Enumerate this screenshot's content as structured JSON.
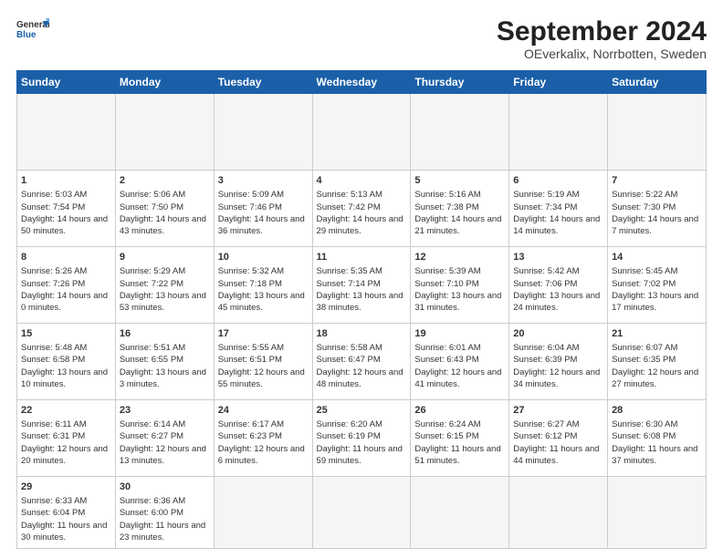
{
  "header": {
    "logo_line1": "General",
    "logo_line2": "Blue",
    "title": "September 2024",
    "subtitle": "OEverkalix, Norrbotten, Sweden"
  },
  "calendar": {
    "days_of_week": [
      "Sunday",
      "Monday",
      "Tuesday",
      "Wednesday",
      "Thursday",
      "Friday",
      "Saturday"
    ],
    "weeks": [
      [
        {
          "day": "",
          "empty": true
        },
        {
          "day": "",
          "empty": true
        },
        {
          "day": "",
          "empty": true
        },
        {
          "day": "",
          "empty": true
        },
        {
          "day": "",
          "empty": true
        },
        {
          "day": "",
          "empty": true
        },
        {
          "day": "",
          "empty": true
        }
      ],
      [
        {
          "num": "1",
          "rise": "Sunrise: 5:03 AM",
          "set": "Sunset: 7:54 PM",
          "daylight": "Daylight: 14 hours and 50 minutes."
        },
        {
          "num": "2",
          "rise": "Sunrise: 5:06 AM",
          "set": "Sunset: 7:50 PM",
          "daylight": "Daylight: 14 hours and 43 minutes."
        },
        {
          "num": "3",
          "rise": "Sunrise: 5:09 AM",
          "set": "Sunset: 7:46 PM",
          "daylight": "Daylight: 14 hours and 36 minutes."
        },
        {
          "num": "4",
          "rise": "Sunrise: 5:13 AM",
          "set": "Sunset: 7:42 PM",
          "daylight": "Daylight: 14 hours and 29 minutes."
        },
        {
          "num": "5",
          "rise": "Sunrise: 5:16 AM",
          "set": "Sunset: 7:38 PM",
          "daylight": "Daylight: 14 hours and 21 minutes."
        },
        {
          "num": "6",
          "rise": "Sunrise: 5:19 AM",
          "set": "Sunset: 7:34 PM",
          "daylight": "Daylight: 14 hours and 14 minutes."
        },
        {
          "num": "7",
          "rise": "Sunrise: 5:22 AM",
          "set": "Sunset: 7:30 PM",
          "daylight": "Daylight: 14 hours and 7 minutes."
        }
      ],
      [
        {
          "num": "8",
          "rise": "Sunrise: 5:26 AM",
          "set": "Sunset: 7:26 PM",
          "daylight": "Daylight: 14 hours and 0 minutes."
        },
        {
          "num": "9",
          "rise": "Sunrise: 5:29 AM",
          "set": "Sunset: 7:22 PM",
          "daylight": "Daylight: 13 hours and 53 minutes."
        },
        {
          "num": "10",
          "rise": "Sunrise: 5:32 AM",
          "set": "Sunset: 7:18 PM",
          "daylight": "Daylight: 13 hours and 45 minutes."
        },
        {
          "num": "11",
          "rise": "Sunrise: 5:35 AM",
          "set": "Sunset: 7:14 PM",
          "daylight": "Daylight: 13 hours and 38 minutes."
        },
        {
          "num": "12",
          "rise": "Sunrise: 5:39 AM",
          "set": "Sunset: 7:10 PM",
          "daylight": "Daylight: 13 hours and 31 minutes."
        },
        {
          "num": "13",
          "rise": "Sunrise: 5:42 AM",
          "set": "Sunset: 7:06 PM",
          "daylight": "Daylight: 13 hours and 24 minutes."
        },
        {
          "num": "14",
          "rise": "Sunrise: 5:45 AM",
          "set": "Sunset: 7:02 PM",
          "daylight": "Daylight: 13 hours and 17 minutes."
        }
      ],
      [
        {
          "num": "15",
          "rise": "Sunrise: 5:48 AM",
          "set": "Sunset: 6:58 PM",
          "daylight": "Daylight: 13 hours and 10 minutes."
        },
        {
          "num": "16",
          "rise": "Sunrise: 5:51 AM",
          "set": "Sunset: 6:55 PM",
          "daylight": "Daylight: 13 hours and 3 minutes."
        },
        {
          "num": "17",
          "rise": "Sunrise: 5:55 AM",
          "set": "Sunset: 6:51 PM",
          "daylight": "Daylight: 12 hours and 55 minutes."
        },
        {
          "num": "18",
          "rise": "Sunrise: 5:58 AM",
          "set": "Sunset: 6:47 PM",
          "daylight": "Daylight: 12 hours and 48 minutes."
        },
        {
          "num": "19",
          "rise": "Sunrise: 6:01 AM",
          "set": "Sunset: 6:43 PM",
          "daylight": "Daylight: 12 hours and 41 minutes."
        },
        {
          "num": "20",
          "rise": "Sunrise: 6:04 AM",
          "set": "Sunset: 6:39 PM",
          "daylight": "Daylight: 12 hours and 34 minutes."
        },
        {
          "num": "21",
          "rise": "Sunrise: 6:07 AM",
          "set": "Sunset: 6:35 PM",
          "daylight": "Daylight: 12 hours and 27 minutes."
        }
      ],
      [
        {
          "num": "22",
          "rise": "Sunrise: 6:11 AM",
          "set": "Sunset: 6:31 PM",
          "daylight": "Daylight: 12 hours and 20 minutes."
        },
        {
          "num": "23",
          "rise": "Sunrise: 6:14 AM",
          "set": "Sunset: 6:27 PM",
          "daylight": "Daylight: 12 hours and 13 minutes."
        },
        {
          "num": "24",
          "rise": "Sunrise: 6:17 AM",
          "set": "Sunset: 6:23 PM",
          "daylight": "Daylight: 12 hours and 6 minutes."
        },
        {
          "num": "25",
          "rise": "Sunrise: 6:20 AM",
          "set": "Sunset: 6:19 PM",
          "daylight": "Daylight: 11 hours and 59 minutes."
        },
        {
          "num": "26",
          "rise": "Sunrise: 6:24 AM",
          "set": "Sunset: 6:15 PM",
          "daylight": "Daylight: 11 hours and 51 minutes."
        },
        {
          "num": "27",
          "rise": "Sunrise: 6:27 AM",
          "set": "Sunset: 6:12 PM",
          "daylight": "Daylight: 11 hours and 44 minutes."
        },
        {
          "num": "28",
          "rise": "Sunrise: 6:30 AM",
          "set": "Sunset: 6:08 PM",
          "daylight": "Daylight: 11 hours and 37 minutes."
        }
      ],
      [
        {
          "num": "29",
          "rise": "Sunrise: 6:33 AM",
          "set": "Sunset: 6:04 PM",
          "daylight": "Daylight: 11 hours and 30 minutes."
        },
        {
          "num": "30",
          "rise": "Sunrise: 6:36 AM",
          "set": "Sunset: 6:00 PM",
          "daylight": "Daylight: 11 hours and 23 minutes."
        },
        {
          "empty": true
        },
        {
          "empty": true
        },
        {
          "empty": true
        },
        {
          "empty": true
        },
        {
          "empty": true
        }
      ]
    ]
  }
}
